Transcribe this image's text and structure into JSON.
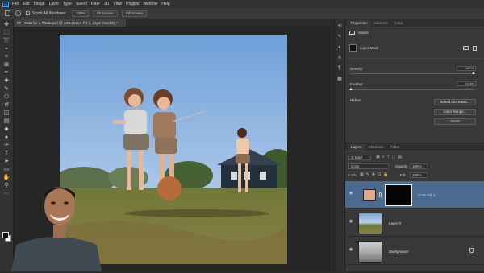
{
  "menubar": {
    "app_icon": "Ps",
    "items": [
      "File",
      "Edit",
      "Image",
      "Layer",
      "Type",
      "Select",
      "Filter",
      "3D",
      "View",
      "Plugins",
      "Window",
      "Help"
    ]
  },
  "options_bar": {
    "scroll_all_windows": "Scroll All Windows",
    "zoom_value": "100%",
    "fit_screen": "Fit Screen",
    "fill_screen": "Fill Screen"
  },
  "document": {
    "tab_title": "07 - Colorize a Photo.psd @ 44% (Color Fill 1, Layer Mask/8) *"
  },
  "properties": {
    "tabs": [
      "Properties",
      "Libraries",
      "Color"
    ],
    "section_title": "Masks",
    "mask_label": "Layer Mask",
    "density_label": "Density:",
    "density_value": "100%",
    "feather_label": "Feather:",
    "feather_value": "0.0 px",
    "refine_label": "Refine:",
    "select_and_mask": "Select and Mask...",
    "color_range": "Color Range...",
    "invert": "Invert"
  },
  "layers": {
    "tabs": [
      "Layers",
      "Channels",
      "Paths"
    ],
    "search_kind": "Q Kind",
    "blend_mode": "Color",
    "opacity_label": "Opacity:",
    "opacity_value": "100%",
    "lock_label": "Lock:",
    "fill_label": "Fill:",
    "fill_value": "100%",
    "items": [
      {
        "name": "Color Fill 1",
        "selected": true
      },
      {
        "name": "Layer 0",
        "selected": false
      },
      {
        "name": "Background",
        "selected": false
      }
    ]
  },
  "colors": {
    "accent": "#31a8ff",
    "selected_layer": "#4b6a8f",
    "fill_swatch": "#e3a886"
  }
}
